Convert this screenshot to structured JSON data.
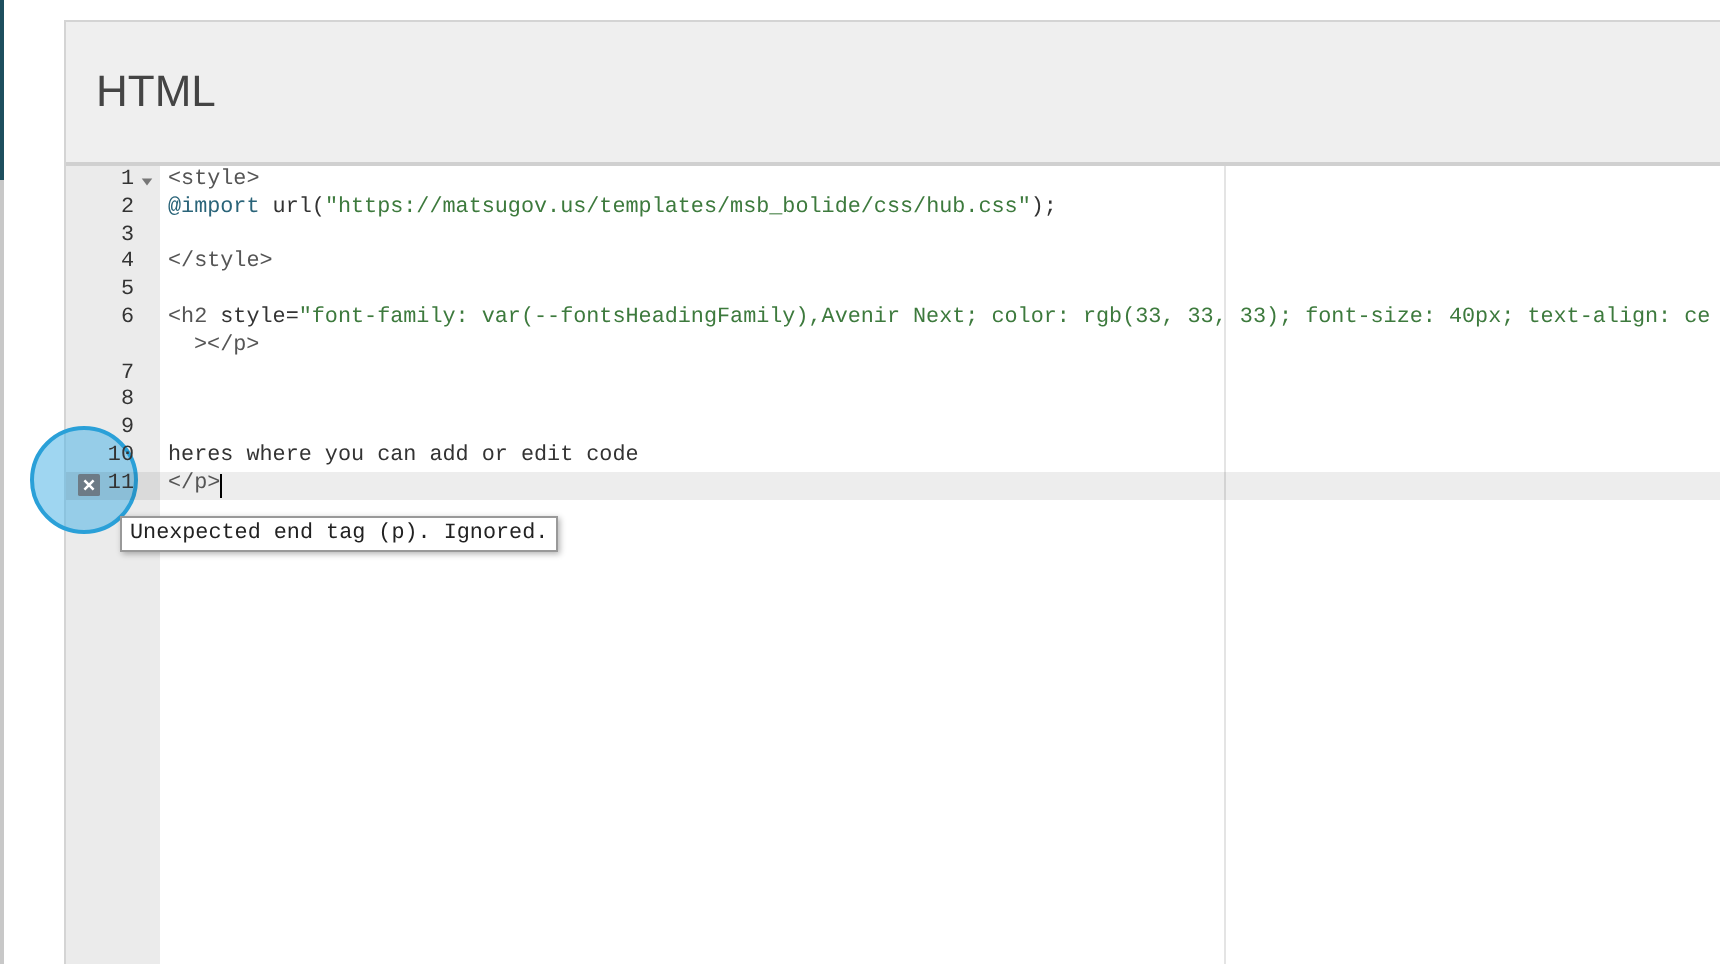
{
  "panel": {
    "title": "HTML"
  },
  "editor": {
    "lines": [
      {
        "number": "1",
        "fold": true,
        "error": false,
        "active": false,
        "tokens": [
          {
            "kind": "tag",
            "text": "<style>"
          }
        ]
      },
      {
        "number": "2",
        "fold": false,
        "error": false,
        "active": false,
        "tokens": [
          {
            "kind": "keyword",
            "text": "@import"
          },
          {
            "kind": "plain",
            "text": " url("
          },
          {
            "kind": "string",
            "text": "\"https://matsugov.us/templates/msb_bolide/css/hub.css\""
          },
          {
            "kind": "plain",
            "text": ");"
          }
        ]
      },
      {
        "number": "3",
        "fold": false,
        "error": false,
        "active": false
      },
      {
        "number": "4",
        "fold": false,
        "error": false,
        "active": false,
        "tokens": [
          {
            "kind": "tag",
            "text": "</style>"
          }
        ]
      },
      {
        "number": "5",
        "fold": false,
        "error": false,
        "active": false
      },
      {
        "number": "6",
        "fold": false,
        "error": false,
        "active": false,
        "tokens": [
          {
            "kind": "tag",
            "text": "<h2"
          },
          {
            "kind": "plain",
            "text": " style="
          },
          {
            "kind": "string",
            "text": "\"font-family: var(--fontsHeadingFamily),Avenir Next; color: rgb(33, 33, 33); font-size: 40px; text-align: ce"
          }
        ],
        "wrap": [
          {
            "kind": "tag",
            "text": "></p>"
          }
        ]
      },
      {
        "number": "7",
        "fold": false,
        "error": false,
        "active": false
      },
      {
        "number": "8",
        "fold": false,
        "error": false,
        "active": false
      },
      {
        "number": "9",
        "fold": false,
        "error": false,
        "active": false
      },
      {
        "number": "10",
        "fold": false,
        "error": false,
        "active": false,
        "tokens": [
          {
            "kind": "plain",
            "text": "heres where you can add or edit code"
          }
        ]
      },
      {
        "number": "11",
        "fold": false,
        "error": true,
        "active": true,
        "cursor": true,
        "tokens": [
          {
            "kind": "tag",
            "text": "</p>"
          }
        ]
      }
    ],
    "tooltip": "Unexpected end tag (p). Ignored."
  }
}
